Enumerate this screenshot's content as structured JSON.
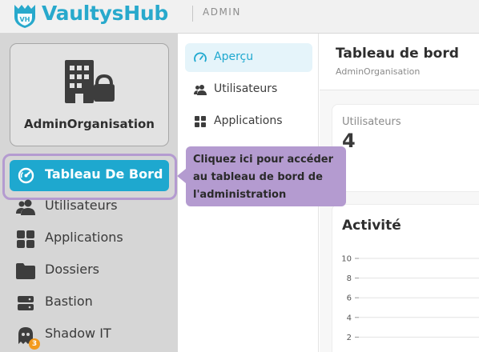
{
  "header": {
    "brand": "VaultysHub",
    "logo_text": "VH",
    "section": "ADMIN"
  },
  "sidebar": {
    "org_name": "AdminOrganisation",
    "items": [
      {
        "label": "Tableau De Bord",
        "icon": "dashboard-gauge-icon",
        "active": true
      },
      {
        "label": "Utilisateurs",
        "icon": "users-icon"
      },
      {
        "label": "Applications",
        "icon": "apps-grid-icon"
      },
      {
        "label": "Dossiers",
        "icon": "folder-icon"
      },
      {
        "label": "Bastion",
        "icon": "server-icon"
      },
      {
        "label": "Shadow IT",
        "icon": "ghost-icon",
        "badge": "3"
      }
    ]
  },
  "subnav": {
    "items": [
      {
        "label": "Aperçu",
        "icon": "gauge-icon",
        "active": true
      },
      {
        "label": "Utilisateurs",
        "icon": "users-icon"
      },
      {
        "label": "Applications",
        "icon": "apps-grid-icon"
      }
    ]
  },
  "main": {
    "title": "Tableau de bord",
    "subtitle": "AdminOrganisation",
    "stat": {
      "label": "Utilisateurs",
      "value": "4"
    },
    "activity_title": "Activité"
  },
  "tooltip": {
    "lines": [
      "Cliquez ici pour accéder",
      "au tableau de bord de",
      "l'administration"
    ]
  },
  "chart_data": {
    "type": "line",
    "title": "Activité",
    "y_ticks": [
      "10",
      "8",
      "6",
      "4",
      "2"
    ],
    "ylim": [
      0,
      10
    ],
    "grid": true
  },
  "colors": {
    "accent": "#1ea8cf",
    "tooltip": "#b49bd0",
    "sidebar_bg": "#d6d6d6",
    "badge": "#f39a1d"
  }
}
